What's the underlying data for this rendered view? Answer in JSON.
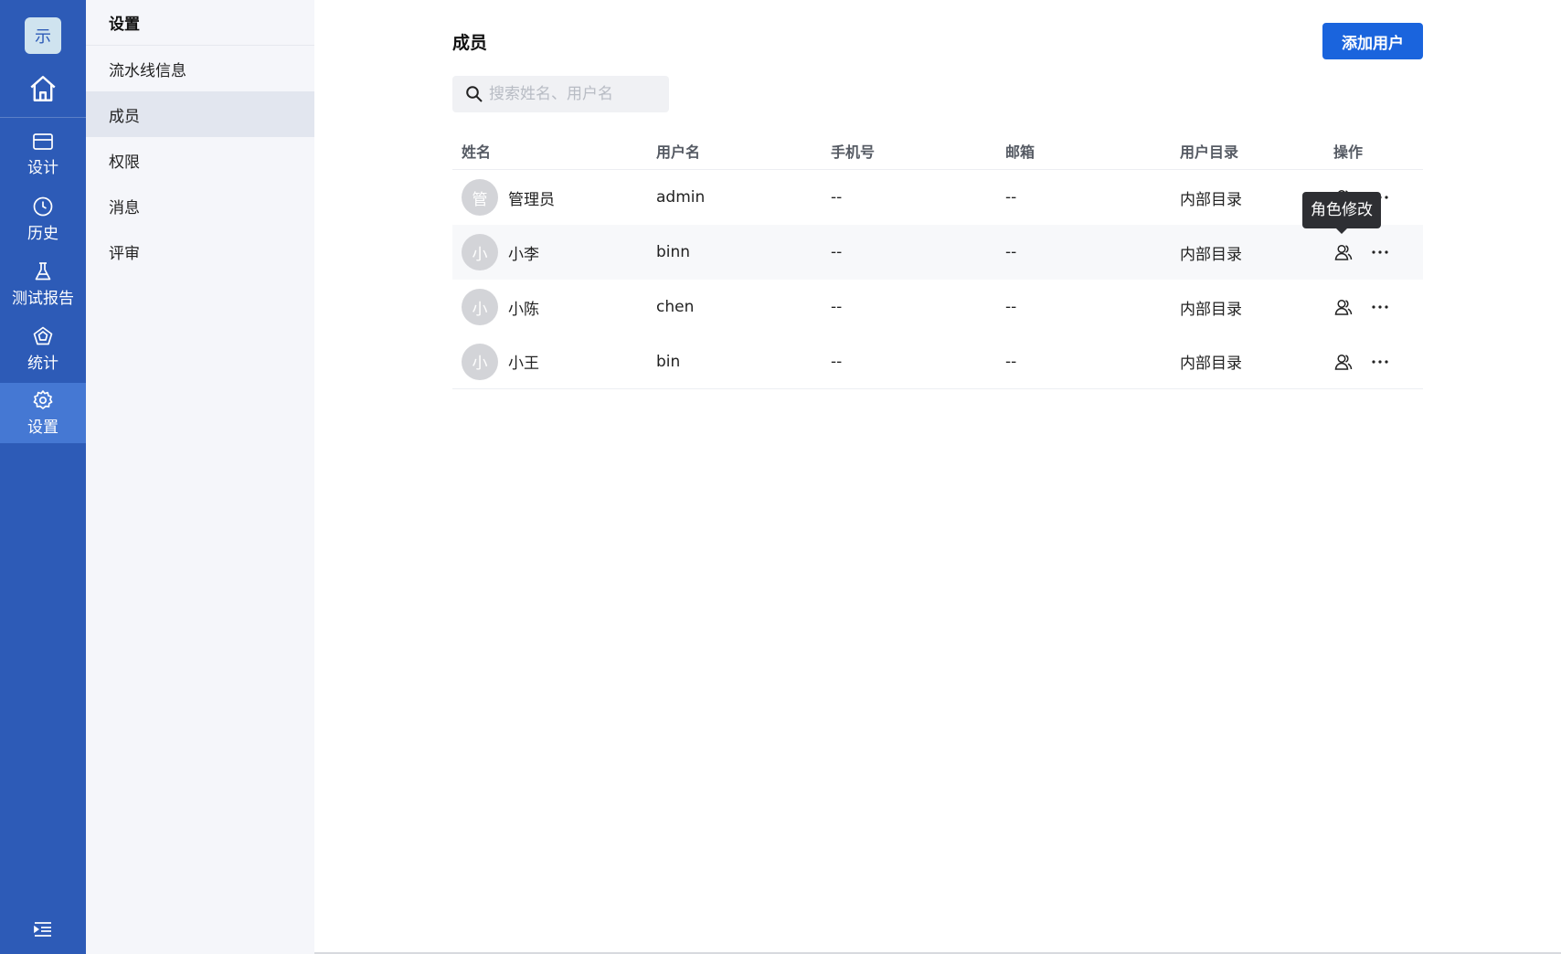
{
  "rail": {
    "logo_text": "示",
    "home_icon": "home-icon",
    "items": [
      {
        "label": "设计",
        "icon": "card-icon"
      },
      {
        "label": "历史",
        "icon": "clock-icon"
      },
      {
        "label": "测试报告",
        "icon": "flask-icon"
      },
      {
        "label": "统计",
        "icon": "pentagon-chart-icon"
      },
      {
        "label": "设置",
        "icon": "gear-icon",
        "active": true
      }
    ],
    "bottom_icon": "expand-menu-icon"
  },
  "submenu": {
    "title": "设置",
    "items": [
      {
        "label": "流水线信息"
      },
      {
        "label": "成员",
        "active": true
      },
      {
        "label": "权限"
      },
      {
        "label": "消息"
      },
      {
        "label": "评审"
      }
    ]
  },
  "main": {
    "title": "成员",
    "add_button": "添加用户",
    "search": {
      "placeholder": "搜索姓名、用户名",
      "value": ""
    },
    "table": {
      "columns": [
        "姓名",
        "用户名",
        "手机号",
        "邮箱",
        "用户目录",
        "操作"
      ],
      "rows": [
        {
          "avatar": "管",
          "name": "管理员",
          "username": "admin",
          "phone": "--",
          "email": "--",
          "directory": "内部目录"
        },
        {
          "avatar": "小",
          "name": "小李",
          "username": "binn",
          "phone": "--",
          "email": "--",
          "directory": "内部目录"
        },
        {
          "avatar": "小",
          "name": "小陈",
          "username": "chen",
          "phone": "--",
          "email": "--",
          "directory": "内部目录"
        },
        {
          "avatar": "小",
          "name": "小王",
          "username": "bin",
          "phone": "--",
          "email": "--",
          "directory": "内部目录"
        }
      ]
    },
    "tooltip": "角色修改",
    "colors": {
      "rail": "#2d5bb7",
      "rail_active": "#4578d3",
      "primary": "#1a64dd"
    }
  }
}
